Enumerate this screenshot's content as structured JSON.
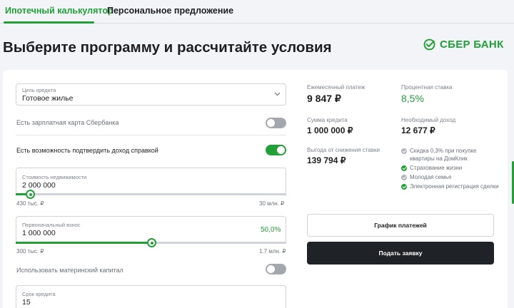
{
  "tabs": [
    {
      "label": "Ипотечный калькулятор",
      "active": true
    },
    {
      "label": "Персональное предложение",
      "active": false
    }
  ],
  "page": {
    "title": "Выберите программу и рассчитайте условия"
  },
  "logo": {
    "text": "СБЕР БАНК",
    "color": "#21a038"
  },
  "form": {
    "purpose": {
      "label": "Цель кредита",
      "value": "Готовое жилье"
    },
    "salary_card": {
      "label": "Есть зарплатная карта Сбербанка",
      "enabled": false
    },
    "income_proof": {
      "label": "Есть возможность подтвердить доход справкой",
      "enabled": true
    },
    "property_value": {
      "label": "Стоимость недвижимости",
      "value": "2 000 000",
      "min": "430 тыс. ₽",
      "max": "30 млн. ₽",
      "level": 0.054
    },
    "down_payment": {
      "label": "Первоначальный взнос",
      "value": "1 000 000",
      "percent": "50,0%",
      "min": "300 тыс. ₽",
      "max": "1.7 млн. ₽",
      "level": 0.5
    },
    "maternity_capital": {
      "label": "Использовать материнский капитал",
      "enabled": false
    },
    "term": {
      "label": "Срок кредита",
      "value": "15"
    }
  },
  "results": {
    "monthly_payment": {
      "label": "Ежемесячный платеж",
      "value": "9 847 ₽"
    },
    "rate": {
      "label": "Процентная ставка",
      "value": "8,5%"
    },
    "loan_amount": {
      "label": "Сумма кредита",
      "value": "1 000 000 ₽"
    },
    "required_income": {
      "label": "Необходимый доход",
      "value": "12 677 ₽"
    },
    "rate_savings": {
      "label": "Выгода от снижения ставки",
      "value": "139 794 ₽"
    },
    "benefits": [
      {
        "text": "Скидка 0,3% при покупке квартиры на ДомКлик",
        "active": false
      },
      {
        "text": "Страхование жизни",
        "active": true
      },
      {
        "text": "Молодая семья",
        "active": false
      },
      {
        "text": "Электронная регистрация сделки",
        "active": true
      }
    ]
  },
  "buttons": {
    "schedule": "График платежей",
    "apply": "Подать заявку"
  },
  "colors": {
    "accent": "#21a038",
    "dark_button": "#1f2327",
    "background": "#f2f4f7"
  }
}
